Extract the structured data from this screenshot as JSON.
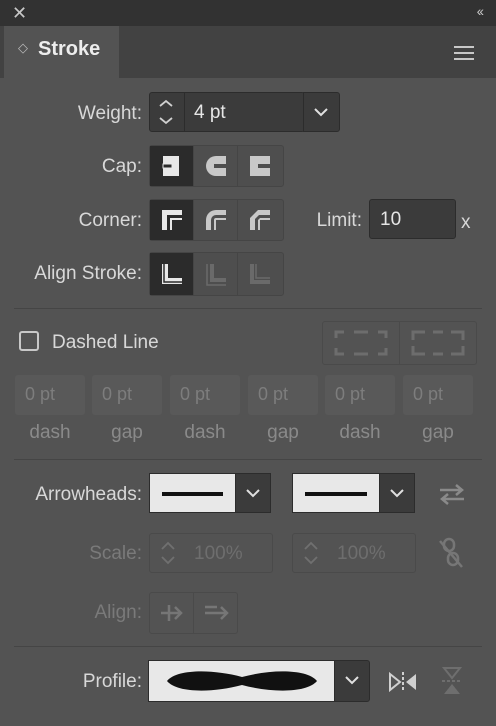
{
  "window": {
    "close_glyph": "✕",
    "collapse_glyph": "‹‹"
  },
  "tab": {
    "title": "Stroke",
    "updown_glyph": "◇"
  },
  "menu_icon": "hamburger-menu-icon",
  "weight": {
    "label": "Weight:",
    "value": "4 pt"
  },
  "cap": {
    "label": "Cap:",
    "options": [
      "butt-cap",
      "round-cap",
      "projecting-cap"
    ],
    "selected": 0
  },
  "corner": {
    "label": "Corner:",
    "options": [
      "miter-join",
      "round-join",
      "bevel-join"
    ],
    "selected": 0
  },
  "limit": {
    "label": "Limit:",
    "value": "10",
    "suffix": "x"
  },
  "align_stroke": {
    "label": "Align Stroke:",
    "options": [
      "align-center",
      "align-inside",
      "align-outside"
    ],
    "selected": 0
  },
  "dashed_line": {
    "label": "Dashed Line",
    "checked": false
  },
  "dash_fields": [
    {
      "value": "0 pt",
      "label": "dash"
    },
    {
      "value": "0 pt",
      "label": "gap"
    },
    {
      "value": "0 pt",
      "label": "dash"
    },
    {
      "value": "0 pt",
      "label": "gap"
    },
    {
      "value": "0 pt",
      "label": "dash"
    },
    {
      "value": "0 pt",
      "label": "gap"
    }
  ],
  "arrowheads": {
    "label": "Arrowheads:",
    "start": "none",
    "end": "none"
  },
  "scale": {
    "label": "Scale:",
    "start_value": "100%",
    "end_value": "100%"
  },
  "align": {
    "label": "Align:"
  },
  "profile": {
    "label": "Profile:"
  },
  "colors": {
    "panel": "#535353",
    "selected_button": "#2b2b2b",
    "field": "#3b3b3b"
  }
}
